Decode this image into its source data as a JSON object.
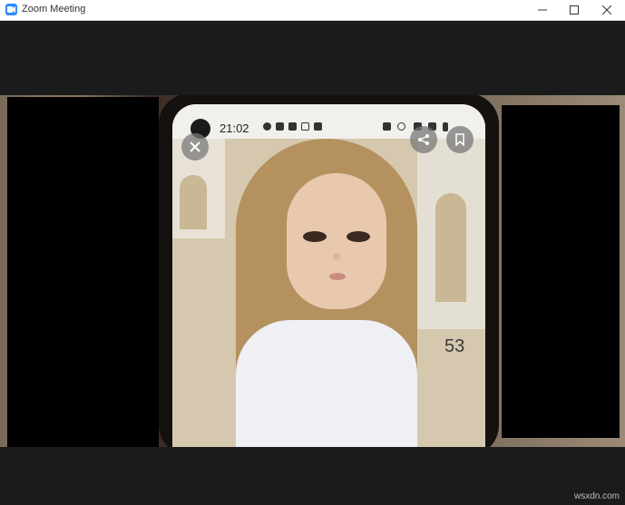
{
  "window": {
    "title": "Zoom Meeting",
    "controls": [
      "minimize",
      "maximize",
      "close"
    ],
    "accent": "#2d8cff"
  },
  "phone_screen": {
    "status_time": "21:02",
    "status_icons_left": [
      "a-icon",
      "image-icon",
      "image-icon",
      "instagram-icon",
      "check-icon"
    ],
    "status_icons_right": [
      "alarm-icon",
      "hotspot-icon",
      "wifi-icon",
      "signal-icon",
      "battery-icon"
    ],
    "overlay_buttons": [
      "close-icon",
      "share-icon",
      "bookmark-icon"
    ],
    "partial_text": "53"
  },
  "watermark": "wsxdn.com"
}
